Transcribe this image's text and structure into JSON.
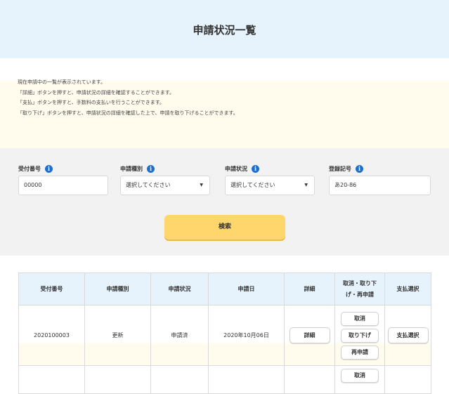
{
  "page": {
    "title": "申請状況一覧"
  },
  "description": {
    "lines": [
      "現在申請中の一覧が表示されています。",
      "「詳細」ボタンを押すと、申請状況の詳細を確認することができます。",
      "「支払」ボタンを押すと、手数料の支払いを行うことができます。",
      "「取り下げ」ボタンを押すと、申請状況の詳細を確認した上で、申請を取り下げることができます。"
    ]
  },
  "search": {
    "fields": [
      {
        "label": "受付番号",
        "value": "00000"
      },
      {
        "label": "申請種別",
        "value": "選択してください"
      },
      {
        "label": "申請状況",
        "value": "選択してください"
      },
      {
        "label": "登録記号",
        "value": "あ20-86"
      }
    ],
    "submit_label": "検索",
    "info_glyph": "i"
  },
  "table": {
    "headers": [
      "受付番号",
      "申請種別",
      "申請状況",
      "申請日",
      "詳細",
      "取消・取り下\nげ・再申請",
      "支払選択"
    ],
    "rows": [
      {
        "receipt_no": "2020100003",
        "type": "更新",
        "status": "申請済",
        "date": "2020年10月06日",
        "detail_label": "詳細",
        "cancel_label": "取消",
        "withdraw_label": "取り下げ",
        "reapply_label": "再申請",
        "pay_label": "支払選択"
      },
      {
        "cancel_label": "取消"
      }
    ]
  },
  "colors": {
    "header_bg": "#e6f3fc",
    "description_bg": "#fffcee",
    "search_bg": "#f2f2f2",
    "search_button": "#ffd66b",
    "info_icon": "#1d6fcf"
  }
}
